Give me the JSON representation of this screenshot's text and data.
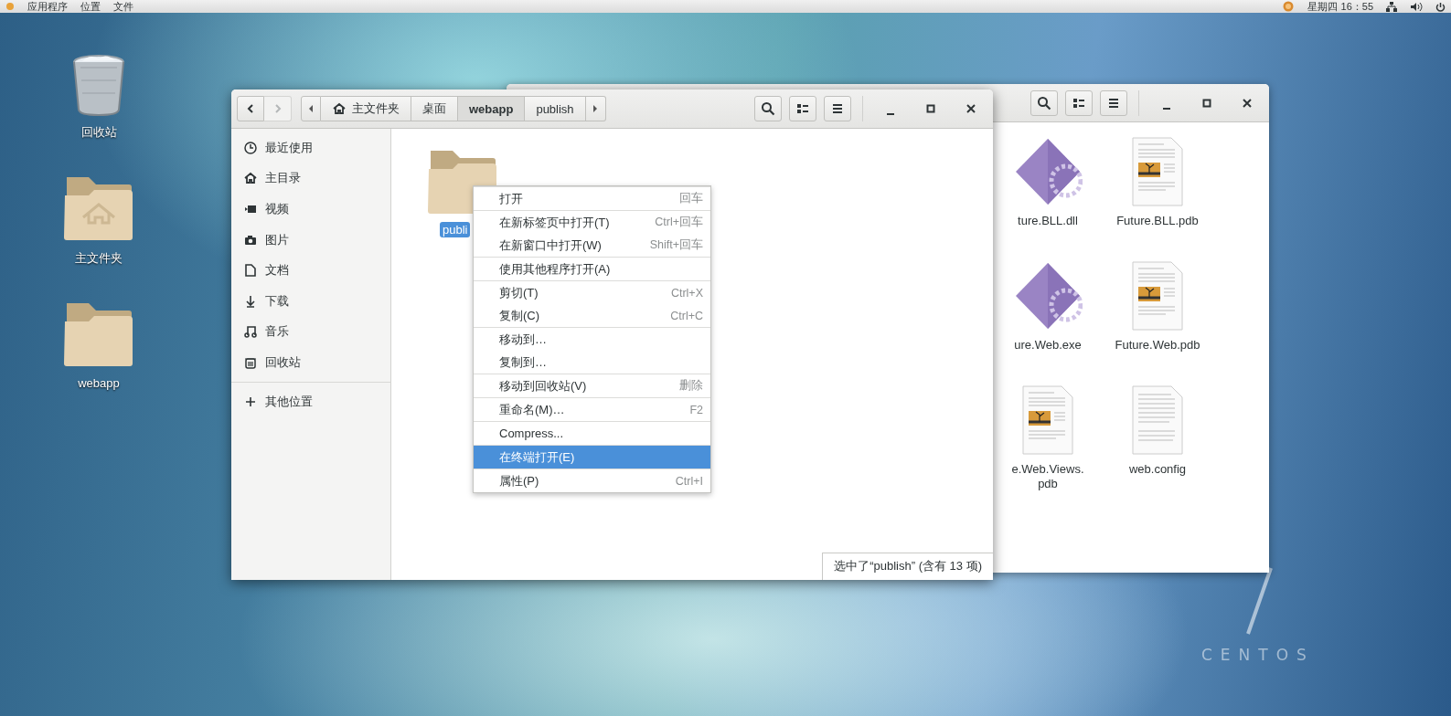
{
  "top_bar": {
    "menus": [
      "应用程序",
      "位置",
      "文件"
    ],
    "clock": "星期四 16：55"
  },
  "desktop_icons": [
    {
      "kind": "trash",
      "label": "回收站"
    },
    {
      "kind": "home-folder",
      "label": "主文件夹"
    },
    {
      "kind": "folder",
      "label": "webapp"
    }
  ],
  "back_window": {
    "files": [
      {
        "kind": "executable",
        "name": "ture.BLL.dll"
      },
      {
        "kind": "document",
        "name": "Future.BLL.pdb"
      },
      {
        "kind": "executable",
        "name": "ure.Web.exe"
      },
      {
        "kind": "document",
        "name": "Future.Web.pdb"
      },
      {
        "kind": "document",
        "name": "e.Web.Views.pdb"
      },
      {
        "kind": "text",
        "name": "web.config"
      }
    ]
  },
  "front_window": {
    "nav": [
      {
        "kind": "back",
        "disabled": false
      },
      {
        "kind": "forward",
        "disabled": true
      }
    ],
    "path": [
      {
        "kind": "home",
        "label": "主文件夹",
        "selected": false
      },
      {
        "kind": "folder",
        "label": "桌面",
        "selected": false
      },
      {
        "kind": "folder",
        "label": "webapp",
        "selected": true
      },
      {
        "kind": "folder",
        "label": "publish",
        "selected": false
      }
    ],
    "sidebar": {
      "places": [
        {
          "kind": "recent",
          "label": "最近使用"
        },
        {
          "kind": "home",
          "label": "主目录"
        },
        {
          "kind": "videos",
          "label": "视频"
        },
        {
          "kind": "pictures",
          "label": "图片"
        },
        {
          "kind": "documents",
          "label": "文档"
        },
        {
          "kind": "downloads",
          "label": "下载"
        },
        {
          "kind": "music",
          "label": "音乐"
        },
        {
          "kind": "trash",
          "label": "回收站"
        }
      ],
      "other_locations": "其他位置"
    },
    "items": [
      {
        "name": "publi",
        "selected": true
      }
    ],
    "status": "选中了“publish” (含有 13 项)"
  },
  "context_menu": {
    "groups": [
      [
        {
          "label": "打开",
          "shortcut": "回车",
          "selected": false
        }
      ],
      [
        {
          "label": "在新标签页中打开(T)",
          "shortcut": "Ctrl+回车",
          "selected": false
        },
        {
          "label": "在新窗口中打开(W)",
          "shortcut": "Shift+回车",
          "selected": false
        }
      ],
      [
        {
          "label": "使用其他程序打开(A)",
          "selected": false
        }
      ],
      [
        {
          "label": "剪切(T)",
          "shortcut": "Ctrl+X",
          "selected": false
        },
        {
          "label": "复制(C)",
          "shortcut": "Ctrl+C",
          "selected": false
        }
      ],
      [
        {
          "label": "移动到…",
          "selected": false
        },
        {
          "label": "复制到…",
          "selected": false
        }
      ],
      [
        {
          "label": "移动到回收站(V)",
          "shortcut": "删除",
          "selected": false
        }
      ],
      [
        {
          "label": "重命名(M)…",
          "shortcut": "F2",
          "selected": false
        }
      ],
      [
        {
          "label": "Compress...",
          "selected": false
        }
      ],
      [
        {
          "label": "在终端打开(E)",
          "selected": true
        }
      ],
      [
        {
          "label": "属性(P)",
          "shortcut": "Ctrl+I",
          "selected": false
        }
      ]
    ]
  },
  "wallpaper_logo": {
    "name": "CENTOS"
  }
}
